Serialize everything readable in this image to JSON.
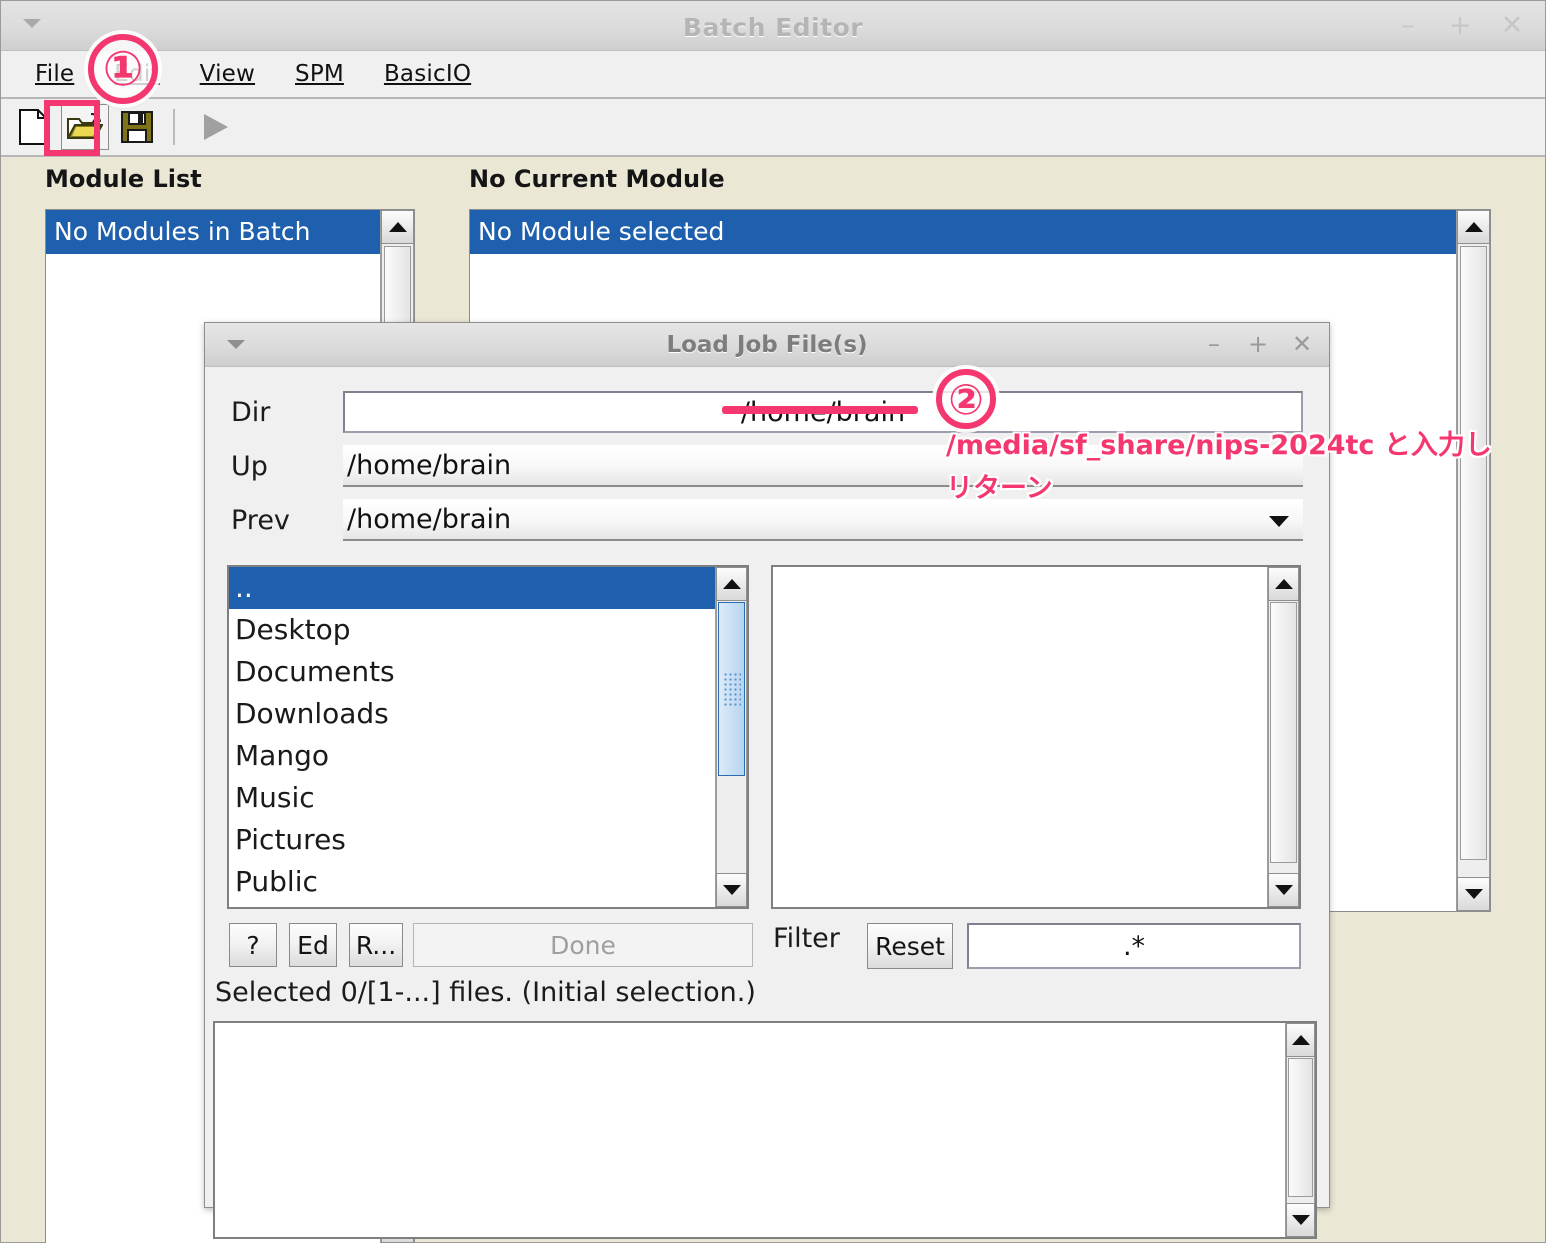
{
  "main_window": {
    "title": "Batch Editor",
    "window_controls": {
      "minimize": "–",
      "maximize": "+",
      "close": "✕"
    },
    "menu": [
      {
        "label": "File",
        "mnemonic": "F"
      },
      {
        "label": "Edit",
        "mnemonic": "E"
      },
      {
        "label": "View",
        "mnemonic": "V"
      },
      {
        "label": "SPM",
        "mnemonic": "S"
      },
      {
        "label": "BasicIO",
        "mnemonic": "B"
      }
    ],
    "toolbar": [
      {
        "name": "new-file-icon",
        "tooltip": "New"
      },
      {
        "name": "open-folder-icon",
        "tooltip": "Open"
      },
      {
        "name": "save-icon",
        "tooltip": "Save"
      },
      {
        "name": "run-icon",
        "tooltip": "Run"
      }
    ],
    "module_list": {
      "heading": "Module List",
      "items": [
        "No Modules in Batch"
      ]
    },
    "current_module": {
      "heading": "No Current Module",
      "items": [
        "No Module selected"
      ]
    }
  },
  "dialog": {
    "title": "Load Job File(s)",
    "window_controls": {
      "minimize": "–",
      "maximize": "+",
      "close": "✕"
    },
    "fields": {
      "dir_label": "Dir",
      "dir_value": "/home/brain",
      "up_label": "Up",
      "up_value": "/home/brain",
      "prev_label": "Prev",
      "prev_value": "/home/brain"
    },
    "dir_list": [
      "..",
      "Desktop",
      "Documents",
      "Downloads",
      "Mango",
      "Music",
      "Pictures",
      "Public"
    ],
    "dir_list_selected_index": 0,
    "file_list": [],
    "buttons": {
      "help": "?",
      "edit": "Ed",
      "rec": "R...",
      "done": "Done",
      "done_enabled": false,
      "reset": "Reset"
    },
    "filter": {
      "label": "Filter",
      "value": ".*"
    },
    "status": "Selected 0/[1-...] files. (Initial selection.)",
    "preview": ""
  },
  "annotations": {
    "accent_color": "#f4386f",
    "step1": "①",
    "step2": "②",
    "note_line1": "/media/sf_share/nips-2024tc と入力し",
    "note_line2": "リターン"
  }
}
